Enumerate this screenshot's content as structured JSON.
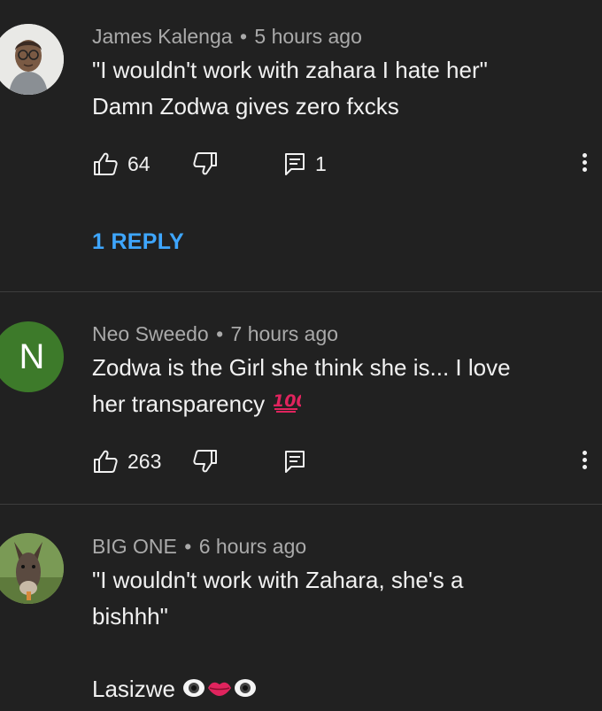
{
  "colors": {
    "background": "#212121",
    "text": "#f1f1f1",
    "meta": "#aaaaaa",
    "reply_link": "#3ea6ff",
    "divider": "#3d3d3d",
    "avatar_n_bg": "#2e7d32"
  },
  "comments": [
    {
      "author": "James Kalenga",
      "time": "5 hours ago",
      "lines": [
        "\"I wouldn't work with zahara I hate her\"",
        "Damn Zodwa gives zero fxcks"
      ],
      "likes": "64",
      "replies_count": "1",
      "reply_link": "1 REPLY",
      "avatar": "avatar-photo-person-glasses"
    },
    {
      "author": "Neo Sweedo",
      "time": "7 hours ago",
      "lines": [
        "Zodwa is the Girl she think she is... I love",
        "her transparency"
      ],
      "emoji": "hundred-points-emoji",
      "likes": "263",
      "avatar_letter": "N"
    },
    {
      "author": "BIG ONE",
      "time": "6 hours ago",
      "lines": [
        "\"I wouldn't work with Zahara, she's a",
        "bishhh\""
      ],
      "tail_text": "Lasizwe",
      "tail_emojis": [
        "eye-emoji",
        "lips-emoji",
        "eye-emoji"
      ],
      "avatar": "avatar-photo-donkey"
    }
  ],
  "separator": "•"
}
